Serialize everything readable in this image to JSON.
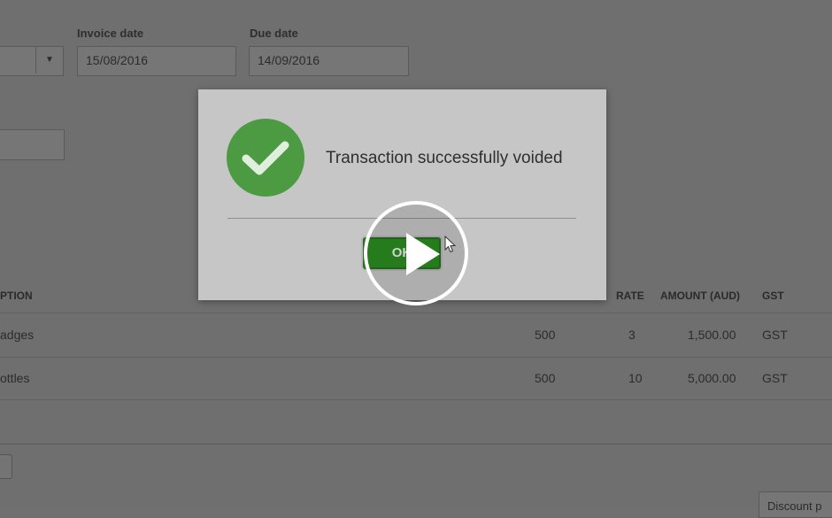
{
  "form": {
    "invoice_date_label": "Invoice date",
    "invoice_date_value": "15/08/2016",
    "due_date_label": "Due date",
    "due_date_value": "14/09/2016"
  },
  "table": {
    "headers": {
      "description": "PTION",
      "rate": "RATE",
      "amount": "AMOUNT (AUD)",
      "gst": "GST"
    },
    "rows": [
      {
        "description": "adges",
        "qty": "500",
        "rate": "3",
        "amount": "1,500.00",
        "gst": "GST"
      },
      {
        "description": "ottles",
        "qty": "500",
        "rate": "10",
        "amount": "5,000.00",
        "gst": "GST"
      }
    ]
  },
  "footer": {
    "discount_label": "Discount p"
  },
  "dialog": {
    "message": "Transaction successfully voided",
    "ok_label": "OK"
  },
  "video": {
    "play_icon": "play-icon"
  }
}
